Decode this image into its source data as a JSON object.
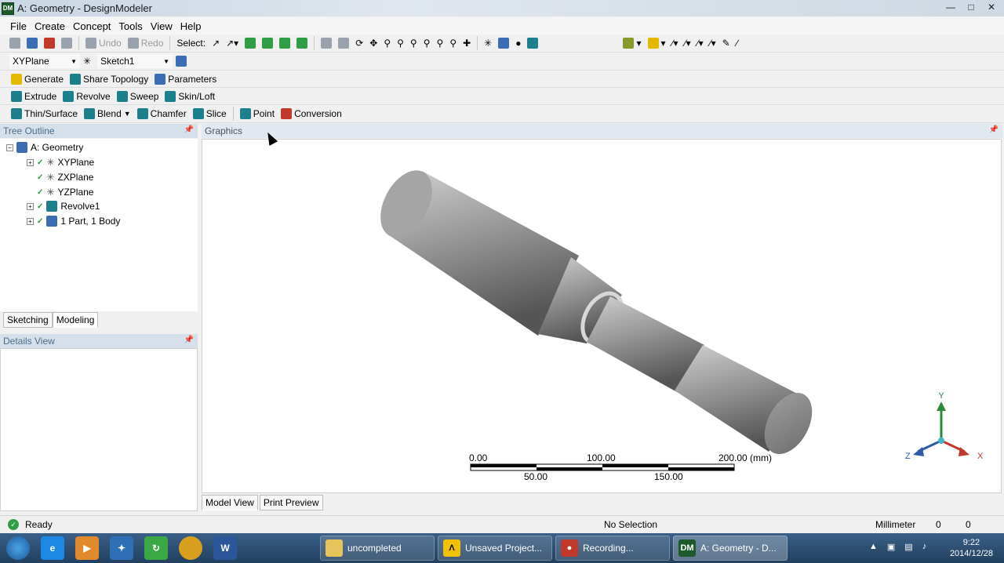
{
  "window": {
    "title": "A: Geometry - DesignModeler",
    "icon_label": "DM"
  },
  "menu": [
    "File",
    "Create",
    "Concept",
    "Tools",
    "View",
    "Help"
  ],
  "toolbar1": {
    "undo": "Undo",
    "redo": "Redo",
    "select": "Select:"
  },
  "toolbar2": {
    "plane": "XYPlane",
    "sketch": "Sketch1"
  },
  "toolbar3": {
    "generate": "Generate",
    "share_topology": "Share Topology",
    "parameters": "Parameters"
  },
  "toolbar4": {
    "extrude": "Extrude",
    "revolve": "Revolve",
    "sweep": "Sweep",
    "skin_loft": "Skin/Loft"
  },
  "toolbar5": {
    "thin_surface": "Thin/Surface",
    "blend": "Blend",
    "chamfer": "Chamfer",
    "slice": "Slice",
    "point": "Point",
    "conversion": "Conversion"
  },
  "tree_outline": {
    "title": "Tree Outline",
    "root": "A: Geometry",
    "items": [
      "XYPlane",
      "ZXPlane",
      "YZPlane",
      "Revolve1",
      "1 Part, 1 Body"
    ]
  },
  "tabs": {
    "sketching": "Sketching",
    "modeling": "Modeling"
  },
  "details_view": {
    "title": "Details View"
  },
  "graphics": {
    "title": "Graphics",
    "scale_top": [
      "0.00",
      "100.00",
      "200.00 (mm)"
    ],
    "scale_bottom": [
      "50.00",
      "150.00"
    ],
    "triad": {
      "x": "X",
      "y": "Y",
      "z": "Z"
    }
  },
  "view_tabs": {
    "model_view": "Model View",
    "print_preview": "Print Preview"
  },
  "status": {
    "ready": "Ready",
    "selection": "No Selection",
    "units": "Millimeter",
    "v1": "0",
    "v2": "0"
  },
  "taskbar": {
    "tasks": [
      "uncompleted",
      "Unsaved Project...",
      "Recording...",
      "A: Geometry - D..."
    ],
    "time": "9:22",
    "date": "2014/12/28"
  }
}
